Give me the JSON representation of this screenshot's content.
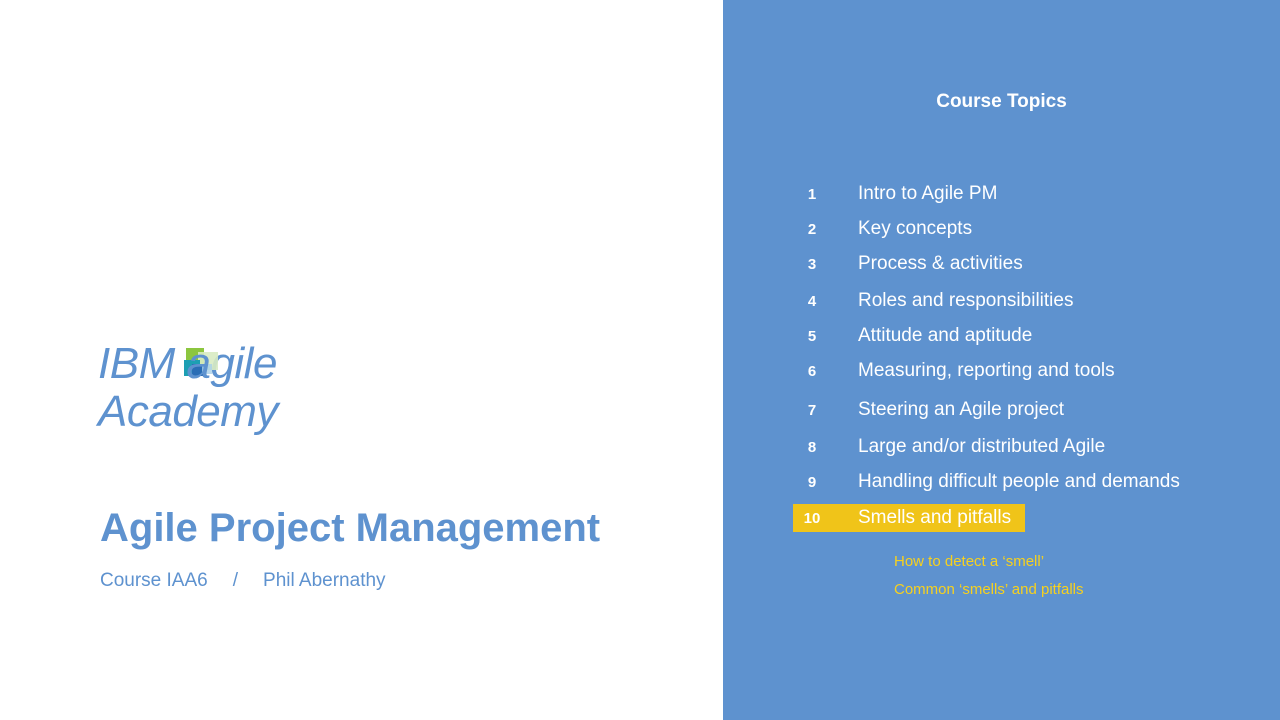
{
  "logo": {
    "line1_prefix": "IBM ",
    "line1_a": "a",
    "line1_suffix": "gile",
    "line2": "Academy"
  },
  "course": {
    "title": "Agile Project Management",
    "code": "Course IAA6",
    "separator": "/",
    "instructor": "Phil Abernathy"
  },
  "topics": {
    "heading": "Course Topics",
    "items": [
      {
        "num": "1",
        "label": "Intro to Agile PM"
      },
      {
        "num": "2",
        "label": "Key concepts"
      },
      {
        "num": "3",
        "label": "Process & activities"
      },
      {
        "num": "4",
        "label": "Roles and responsibilities"
      },
      {
        "num": "5",
        "label": "Attitude and aptitude"
      },
      {
        "num": "6",
        "label": "Measuring, reporting and tools"
      },
      {
        "num": "7",
        "label": "Steering an Agile project"
      },
      {
        "num": "8",
        "label": "Large and/or distributed Agile"
      },
      {
        "num": "9",
        "label": "Handling difficult people and demands"
      },
      {
        "num": "10",
        "label": "Smells and pitfalls"
      }
    ],
    "active_index": 9,
    "subitems": [
      "How to detect a ‘smell’",
      "Common ‘smells’ and pitfalls"
    ]
  },
  "colors": {
    "brand_blue": "#5e92cf",
    "highlight_yellow": "#f0c419",
    "subitem_yellow": "#f7d11e",
    "logo_green": "#8cc63f",
    "logo_teal": "#1d9fb3",
    "logo_blue": "#2a6db5"
  }
}
